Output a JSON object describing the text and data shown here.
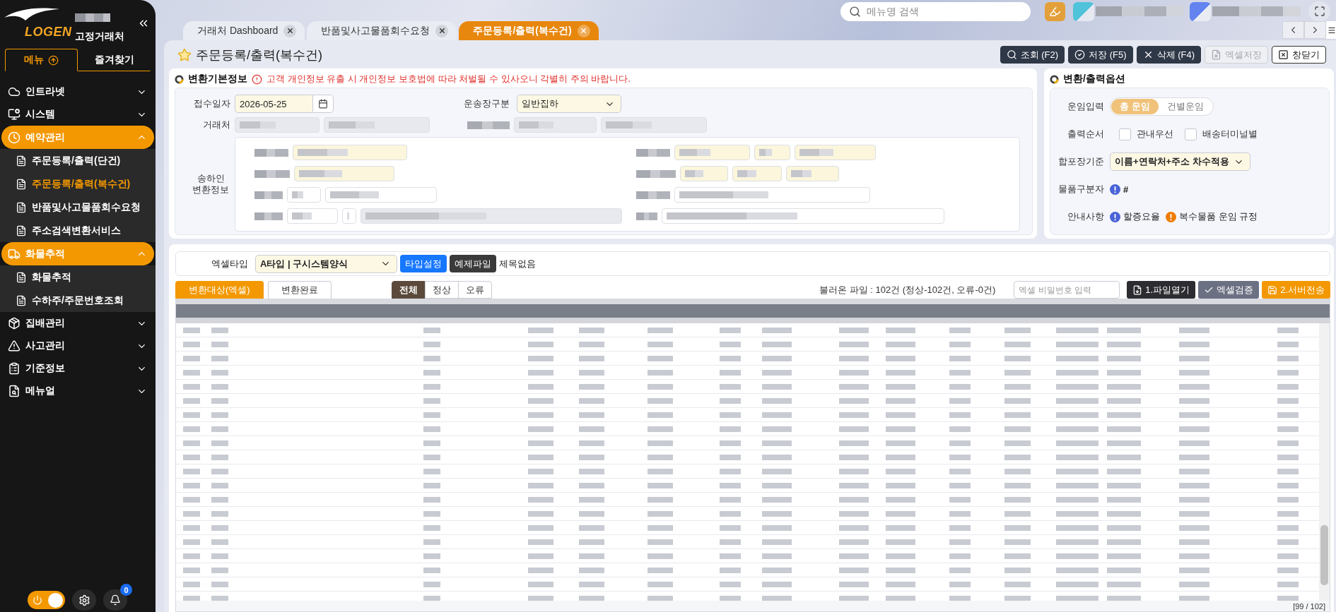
{
  "sidebar": {
    "logo": "LOGEN",
    "account_type": "고정거래처",
    "tabs": [
      {
        "label": "메뉴",
        "selected": true
      },
      {
        "label": "즐겨찾기",
        "selected": false
      }
    ],
    "menu": [
      {
        "label": "인트라넷",
        "expanded": false
      },
      {
        "label": "시스템",
        "expanded": false
      },
      {
        "label": "예약관리",
        "expanded": true,
        "children": [
          {
            "label": "주문등록/출력(단건)",
            "selected": false
          },
          {
            "label": "주문등록/출력(복수건)",
            "selected": true
          },
          {
            "label": "반품및사고물품회수요청",
            "selected": false
          },
          {
            "label": "주소검색변환서비스",
            "selected": false
          }
        ]
      },
      {
        "label": "화물추적",
        "expanded": true,
        "children": [
          {
            "label": "화물추적",
            "selected": false
          },
          {
            "label": "수하주/주문번호조회",
            "selected": false
          }
        ]
      },
      {
        "label": "집배관리",
        "expanded": false
      },
      {
        "label": "사고관리",
        "expanded": false
      },
      {
        "label": "기준정보",
        "expanded": false
      },
      {
        "label": "메뉴얼",
        "expanded": false
      }
    ],
    "power_toggle": {
      "on": true
    },
    "notifications": {
      "count": "0"
    }
  },
  "topbar": {
    "search": {
      "placeholder": "메뉴명 검색"
    }
  },
  "tabs": [
    {
      "label": "거래처 Dashboard",
      "selected": false
    },
    {
      "label": "반품및사고물품회수요청",
      "selected": false
    },
    {
      "label": "주문등록/출력(복수건)",
      "selected": true
    }
  ],
  "page": {
    "title": "주문등록/출력(복수건)",
    "toolbar": [
      {
        "label": "조회 (F2)",
        "kind": "search",
        "disabled": false
      },
      {
        "label": "저장 (F5)",
        "kind": "save",
        "disabled": false
      },
      {
        "label": "삭제 (F4)",
        "kind": "delete",
        "disabled": false
      },
      {
        "label": "엑셀저장",
        "kind": "excel",
        "disabled": true
      },
      {
        "label": "창닫기",
        "kind": "close",
        "disabled": false
      }
    ]
  },
  "basic_info": {
    "title": "변환기본정보",
    "warning": "고객 개인정보 유출 시 개인정보 보호법에 따라 처벌될 수 있사오니 각별히 주의 바랍니다.",
    "receipt_date": {
      "label": "접수일자",
      "value": "2026-05-25"
    },
    "waybill_type": {
      "label": "운송장구분",
      "value": "일반집하"
    },
    "client": {
      "label": "거래처"
    },
    "shipper": {
      "label": "송하인 변환정보"
    }
  },
  "options": {
    "title": "변환/출력옵션",
    "fare_input": {
      "label": "운임입력",
      "options": [
        {
          "label": "총 운임",
          "selected": true
        },
        {
          "label": "건별운임",
          "selected": false
        }
      ]
    },
    "output_order": {
      "label": "출력순서",
      "options": [
        {
          "label": "관내우선",
          "checked": false
        },
        {
          "label": "배송터미널별",
          "checked": false
        }
      ]
    },
    "merge_basis": {
      "label": "합포장기준",
      "value": "이름+연락처+주소 차수적용"
    },
    "item_separator": {
      "label": "물품구분자",
      "value": "#"
    },
    "notices": {
      "label": "안내사항",
      "items": [
        {
          "label": "할증요율",
          "color": "#4a63d8"
        },
        {
          "label": "복수물품 운임 규정",
          "color": "#f07c00"
        }
      ]
    }
  },
  "upload": {
    "excel_type": {
      "label": "엑셀타입",
      "value": "A타입 | 구시스템양식"
    },
    "type_buttons": [
      {
        "label": "타입설정",
        "kind": "primary"
      },
      {
        "label": "예제파일",
        "kind": "dark"
      }
    ],
    "file_name": "제목없음",
    "view_tabs": [
      {
        "label": "변환대상(엑셀)",
        "selected": true
      },
      {
        "label": "변환완료",
        "selected": false
      }
    ],
    "filters": [
      {
        "label": "전체",
        "selected": true
      },
      {
        "label": "정상",
        "selected": false
      },
      {
        "label": "오류",
        "selected": false
      }
    ],
    "summary": "불러온 파일 : 102건 (정상-102건, 오류-0건)",
    "password": {
      "placeholder": "엑셀 비밀번호 입력"
    },
    "actions": [
      {
        "label": "1.파일열기",
        "kind": "open"
      },
      {
        "label": "엑셀검증",
        "kind": "verify"
      },
      {
        "label": "2.서버전송",
        "kind": "send"
      }
    ]
  },
  "table": {
    "pager": "[99 / 102]"
  }
}
